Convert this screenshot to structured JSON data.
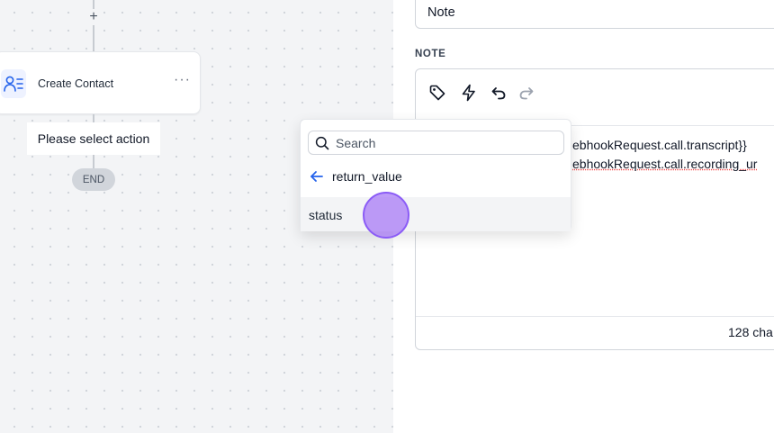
{
  "workflow": {
    "add_step_symbol": "+",
    "node": {
      "title": "Create Contact",
      "menu_symbol": "···",
      "icon": "user-list-icon"
    },
    "placeholder_action": "Please select action",
    "end_label": "END"
  },
  "panel": {
    "action_type_value": "Note",
    "section_label": "NOTE",
    "toolbar": {
      "icons": [
        "tag-icon",
        "lightning-icon",
        "undo-icon",
        "redo-icon"
      ]
    },
    "editor": {
      "line1": "ebhookRequest.call.transcript}}",
      "line2": "ebhookRequest.call.recording_ur"
    },
    "char_count": "128 cha"
  },
  "dropdown": {
    "search_placeholder": "Search",
    "back_label": "return_value",
    "options": [
      {
        "label": "status"
      }
    ]
  },
  "colors": {
    "accent": "#2563eb",
    "cursor": "#a87bf5"
  }
}
